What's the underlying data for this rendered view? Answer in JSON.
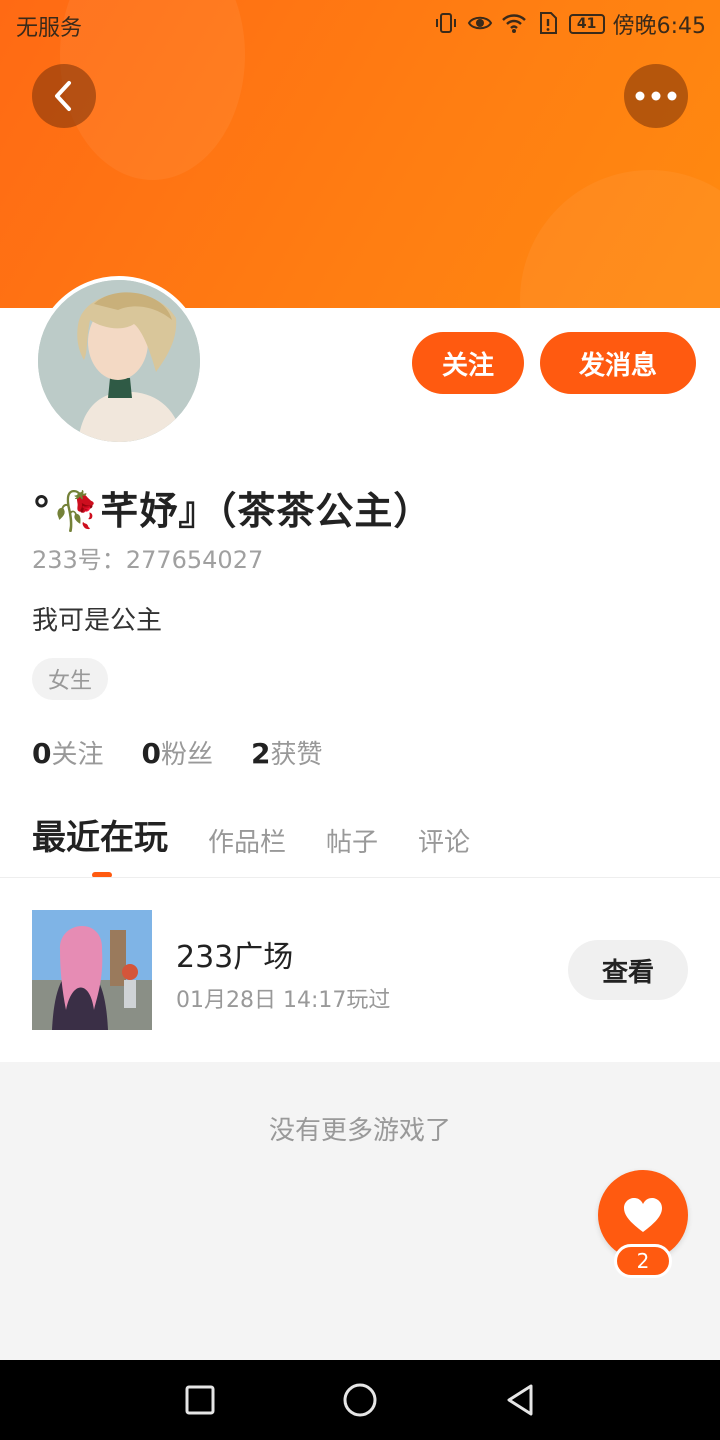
{
  "status_bar": {
    "carrier": "无服务",
    "battery": "41",
    "time": "傍晚6:45"
  },
  "nav": {
    "back_icon": "chevron-left-icon",
    "more_icon": "more-dots-icon"
  },
  "profile": {
    "name": "°🥀芊妤』（茶茶公主）",
    "id_label": "233号：277654027",
    "bio": "我可是公主",
    "gender_tag": "女生",
    "follow_button": "关注",
    "message_button": "发消息"
  },
  "stats": {
    "following_count": "0",
    "following_label": "关注",
    "fans_count": "0",
    "fans_label": "粉丝",
    "likes_count": "2",
    "likes_label": "获赞"
  },
  "tabs": [
    {
      "label": "最近在玩",
      "active": true
    },
    {
      "label": "作品栏",
      "active": false
    },
    {
      "label": "帖子",
      "active": false
    },
    {
      "label": "评论",
      "active": false
    }
  ],
  "recent_games": [
    {
      "title": "233广场",
      "played": "01月28日 14:17玩过",
      "action": "查看"
    }
  ],
  "footer_text": "没有更多游戏了",
  "like_fab": {
    "count": "2"
  },
  "colors": {
    "accent": "#ff5a10",
    "banner": "#ff7a12"
  }
}
